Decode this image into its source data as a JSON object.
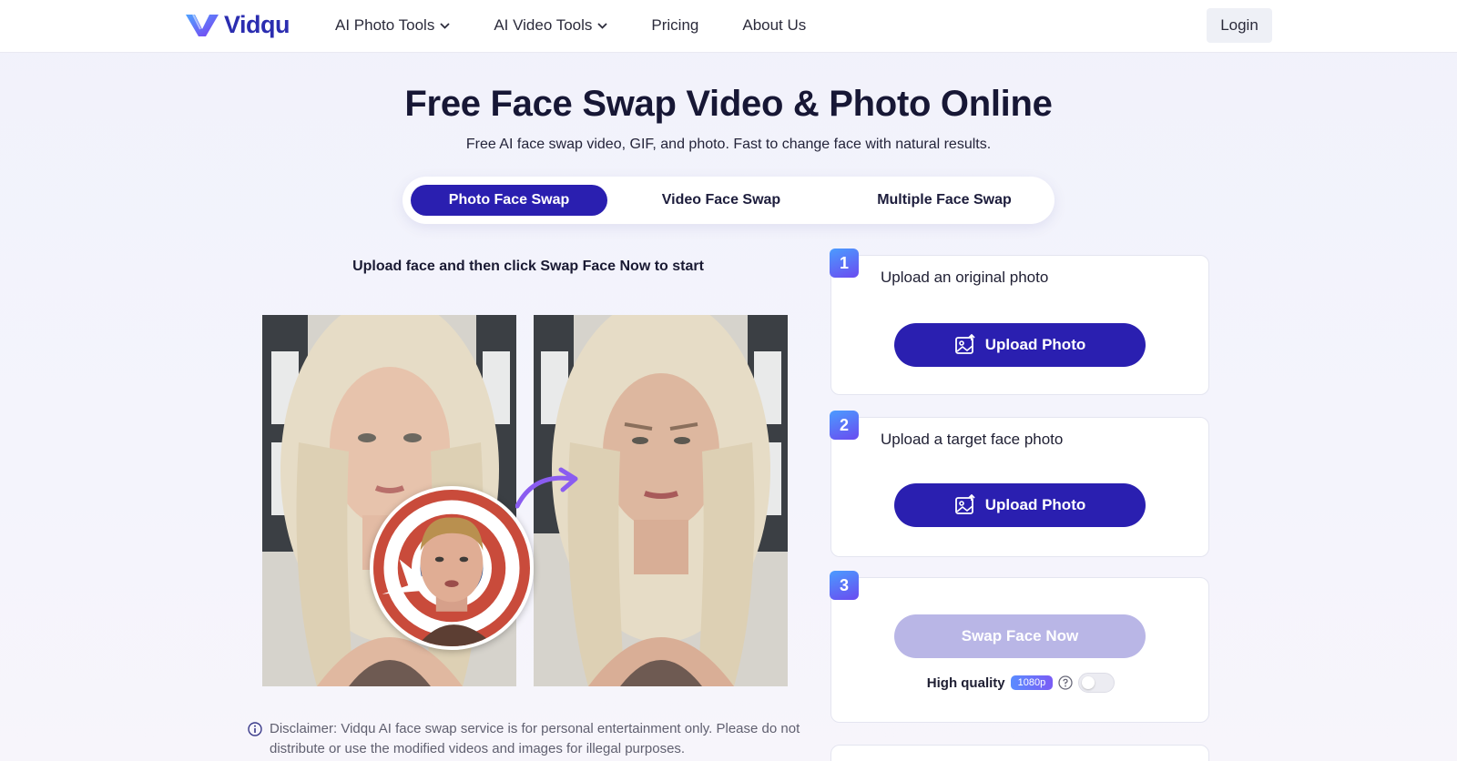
{
  "header": {
    "logo_text": "Vidqu",
    "nav": [
      {
        "label": "AI Photo Tools"
      },
      {
        "label": "AI Video Tools"
      },
      {
        "label": "Pricing"
      },
      {
        "label": "About Us"
      }
    ],
    "login_label": "Login"
  },
  "hero": {
    "title": "Free Face Swap Video & Photo Online",
    "subtitle": "Free AI face swap video, GIF, and photo. Fast to change face with natural results."
  },
  "tabs": [
    {
      "label": "Photo Face Swap",
      "active": true
    },
    {
      "label": "Video Face Swap",
      "active": false
    },
    {
      "label": "Multiple Face Swap",
      "active": false
    }
  ],
  "demo": {
    "instruction": "Upload face and then click Swap Face Now to start"
  },
  "steps": [
    {
      "number": "1",
      "label": "Upload an original photo",
      "button": "Upload Photo"
    },
    {
      "number": "2",
      "label": "Upload a target face photo",
      "button": "Upload Photo"
    },
    {
      "number": "3",
      "label": "",
      "button": "Swap Face Now"
    }
  ],
  "quality": {
    "label": "High quality",
    "badge": "1080p",
    "enabled": false
  },
  "disclaimer": "Disclaimer: Vidqu AI face swap service is for personal entertainment only. Please do not distribute or use the modified videos and images for illegal purposes.",
  "colors": {
    "primary": "#2a1fb0",
    "disabled": "#b9b6e6",
    "badge_gradient_start": "#4b9cff",
    "badge_gradient_end": "#6a4bf0"
  }
}
